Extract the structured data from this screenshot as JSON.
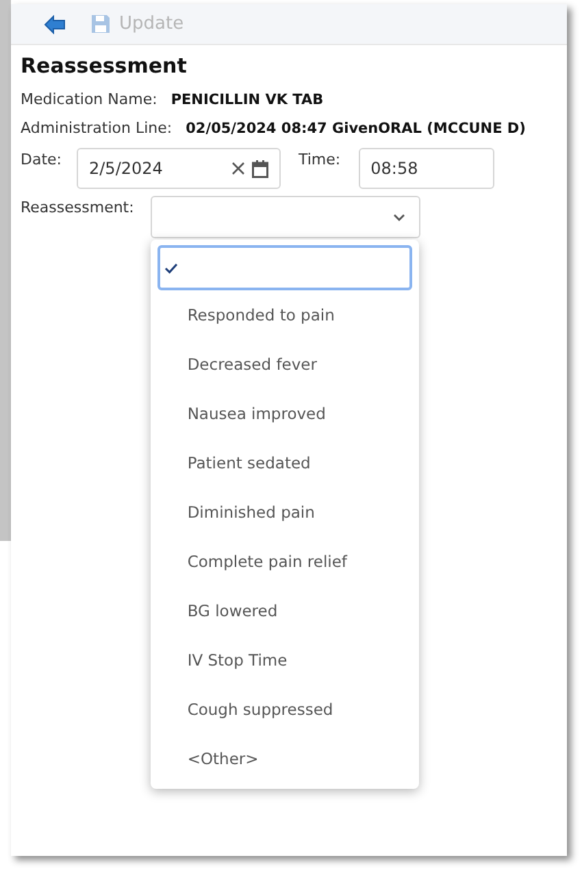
{
  "toolbar": {
    "update_button": {
      "label": "Update",
      "disabled": true
    }
  },
  "title": "Reassessment",
  "medication": {
    "label": "Medication Name:",
    "value": "PENICILLIN VK TAB"
  },
  "administration": {
    "label": "Administration Line:",
    "value": "02/05/2024 08:47 GivenORAL (MCCUNE D)"
  },
  "date": {
    "label": "Date:",
    "value": "2/5/2024"
  },
  "time": {
    "label": "Time:",
    "value": "08:58"
  },
  "reassessment": {
    "label": "Reassessment:",
    "expanded": true,
    "options": [
      {
        "selected": true
      },
      {
        "label": "Responded to pain",
        "selected": false
      },
      {
        "label": "Decreased fever",
        "selected": false
      },
      {
        "label": "Nausea improved",
        "selected": false
      },
      {
        "label": "Patient sedated",
        "selected": false
      },
      {
        "label": "Diminished pain",
        "selected": false
      },
      {
        "label": "Complete pain relief",
        "selected": false
      },
      {
        "label": "BG lowered",
        "selected": false
      },
      {
        "label": "IV Stop Time",
        "selected": false
      },
      {
        "label": "Cough suppressed",
        "selected": false
      },
      {
        "label": "<Other>",
        "selected": false
      }
    ]
  }
}
